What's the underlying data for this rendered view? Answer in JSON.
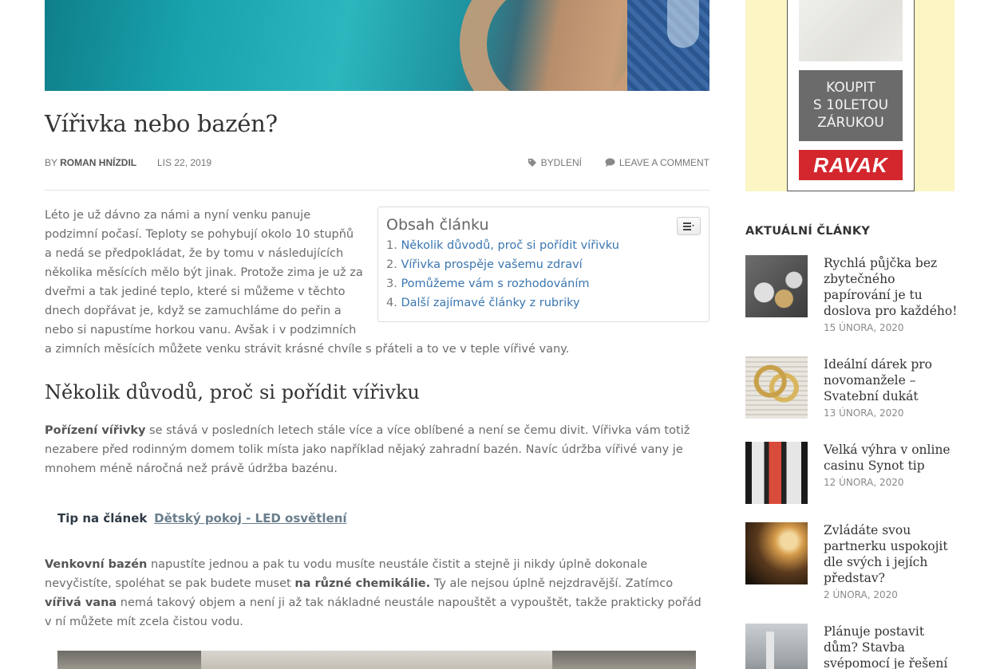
{
  "post": {
    "title": "Vířivka nebo bazén?",
    "meta": {
      "by_prefix": "BY",
      "author": "ROMAN HNÍZDIL",
      "date": "LIS 22, 2019",
      "category": "BYDLENÍ",
      "comment_link": "LEAVE A COMMENT"
    },
    "toc": {
      "title": "Obsah článku",
      "items": [
        {
          "num": "1.",
          "label": "Několik důvodů, proč si pořídit vířivku"
        },
        {
          "num": "2.",
          "label": "Vířivka prospěje vašemu zdraví"
        },
        {
          "num": "3.",
          "label": "Pomůžeme vám s rozhodováním"
        },
        {
          "num": "4.",
          "label": "Další zajímavé články z rubriky"
        }
      ]
    },
    "intro": "Léto je už dávno za námi a nyní venku panuje podzimní počasí. Teploty se pohybují okolo 10 stupňů a nedá se předpokládat, že by tomu v následujících několika měsících mělo být jinak. Protože zima je už za dveřmi a tak jediné teplo, které si můžeme v těchto dnech dopřávat je, když se zamuchláme do peřin a nebo si napustíme horkou vanu. Avšak i v podzimních a zimních měsících můžete venku strávit krásné chvíle s přáteli a to ve v teple vířivé vany.",
    "section_heading": "Několik důvodů, proč si pořídit vířivku",
    "p2": {
      "bold": "Pořízení vířivky",
      "text": " se stává v posledních letech stále více a více oblíbené a není se čemu divit. Vířivka vám totiž nezabere před rodinným domem tolik místa jako například nějaký zahradní bazén. Navíc údržba vířivé vany je mnohem méně náročná než právě údržba bazénu."
    },
    "tip": {
      "label": "Tip na článek",
      "link": "Dětský pokoj - LED osvětlení"
    },
    "p3": {
      "b1": "Venkovní bazén",
      "t1": " napustíte jednou a pak tu vodu musíte neustále čistit a stejně ji nikdy úplně dokonale nevyčistíte, spoléhat se pak budete muset ",
      "b2": "na různé chemikálie.",
      "t2": " Ty ale nejsou úplně nejzdravější. Zatímco ",
      "b3": "vířivá vana",
      "t3": " nemá takový objem a není ji až tak nákladné neustále napouštět a vypouštět, takže prakticky pořád v ní můžete mít zcela čistou vodu."
    }
  },
  "sidebar": {
    "ad": {
      "cta": "KOUPIT\nS 10LETOU\nZÁRUKOU",
      "brand": "RAVAK"
    },
    "widget_title": "AKTUÁLNÍ ČLÁNKY",
    "articles": [
      {
        "title": "Rychlá půjčka bez zbytečného papírování je tu doslova pro každého!",
        "date": "15 ÚNORA, 2020"
      },
      {
        "title": "Ideální dárek pro novomanžele – Svatební dukát",
        "date": "13 ÚNORA, 2020"
      },
      {
        "title": "Velká výhra v online casinu Synot tip",
        "date": "12 ÚNORA, 2020"
      },
      {
        "title": "Zvládáte svou partnerku uspokojit dle svých i jejích představ?",
        "date": "2 ÚNORA, 2020"
      },
      {
        "title": "Plánuje postavit dům? Stavba svépomocí je řešení pro odvážné",
        "date": ""
      }
    ]
  },
  "colors": {
    "link": "#3a76b0",
    "heading": "#333333",
    "ad_background": "#fbf6c4",
    "brand_red": "#d4262d"
  }
}
